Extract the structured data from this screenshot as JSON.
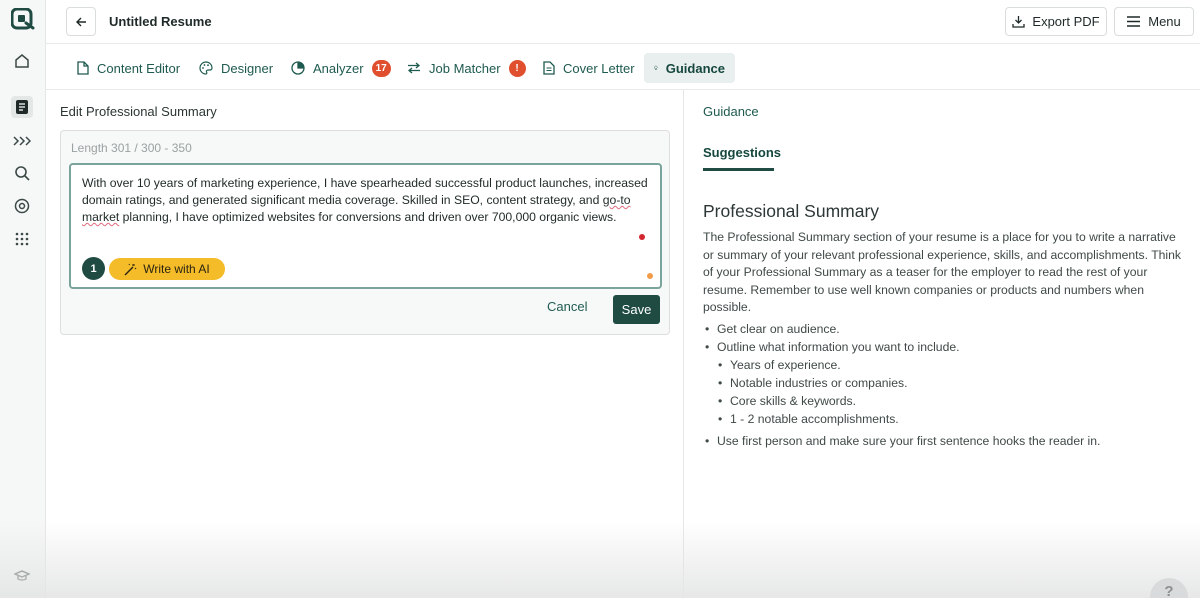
{
  "header": {
    "title": "Untitled Resume",
    "export_label": "Export PDF",
    "menu_label": "Menu"
  },
  "tabs": [
    {
      "label": "Content Editor",
      "icon": "file-icon"
    },
    {
      "label": "Designer",
      "icon": "palette-icon"
    },
    {
      "label": "Analyzer",
      "icon": "pie-chart-icon",
      "badge": "17"
    },
    {
      "label": "Job Matcher",
      "icon": "arrows-icon",
      "badge": "!"
    },
    {
      "label": "Cover Letter",
      "icon": "document-icon"
    },
    {
      "label": "Guidance",
      "icon": "lightbulb-icon",
      "active": true
    }
  ],
  "editor": {
    "heading": "Edit Professional Summary",
    "length": "Length 301 / 300 - 350",
    "text_part1": "With over 10 years of marketing experience, I have spearheaded successful product launches, increased domain ratings, and generated significant media coverage. Skilled in SEO, content strategy, and ",
    "text_underlined": "go-to market",
    "text_part2": " planning, I have optimized websites for conversions and driven over 700,000 organic views.",
    "step": "1",
    "write_ai": "Write with AI",
    "cancel": "Cancel",
    "save": "Save"
  },
  "guidance": {
    "link": "Guidance",
    "tab": "Suggestions",
    "title": "Professional Summary",
    "paragraph": "The Professional Summary section of your resume is a place for you to write a narrative or summary of your relevant professional experience, skills, and accomplishments. Think of your Professional Summary as a teaser for the employer to read the rest of your resume. Remember to use well known companies or products and numbers when possible.",
    "bullet1": "Get clear on audience.",
    "bullet2": "Outline what information you want to include.",
    "sub_bullets": [
      "Years of experience.",
      "Notable industries or companies.",
      "Core skills & keywords.",
      "1 - 2 notable accomplishments."
    ],
    "bullet3": "Use first person and make sure your first sentence hooks the reader in."
  },
  "help": "?",
  "colors": {
    "primary": "#1f4b43",
    "accent_yellow": "#f4bc29",
    "badge_red": "#e0502f"
  }
}
